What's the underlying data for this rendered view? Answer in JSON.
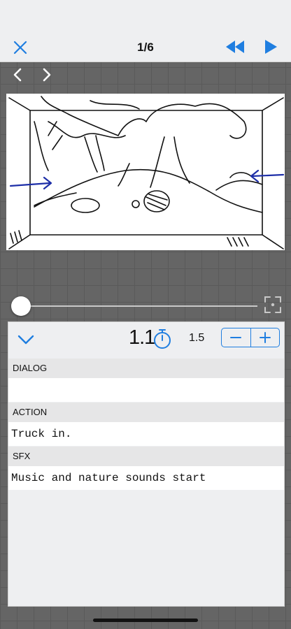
{
  "header": {
    "close_icon": "close-icon",
    "title": "1/6",
    "rewind_icon": "rewind-icon",
    "play_icon": "play-icon",
    "accent": "#1f7ee0"
  },
  "panel_nav": {
    "prev_icon": "chevron-left-icon",
    "next_icon": "chevron-right-icon"
  },
  "storyboard": {
    "image": "sketch-forest-clearing",
    "progress": 0.0
  },
  "editor": {
    "collapse_icon": "chevron-down-icon",
    "duration": "1.1",
    "timer_icon": "stopwatch-icon",
    "step_value": "1.5",
    "minus": "−",
    "plus": "+",
    "sections": [
      {
        "label": "DIALOG",
        "value": ""
      },
      {
        "label": "ACTION",
        "value": "Truck in."
      },
      {
        "label": "SFX",
        "value": "Music and nature sounds start"
      }
    ]
  }
}
